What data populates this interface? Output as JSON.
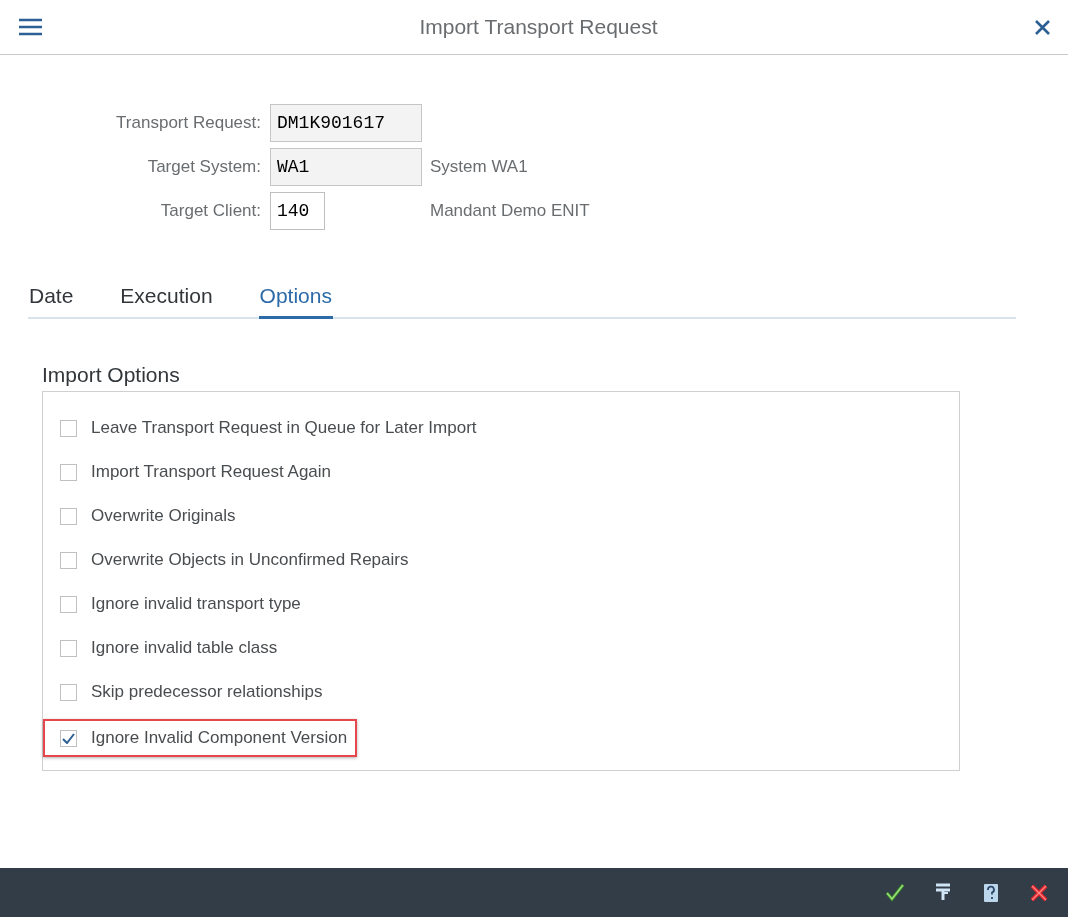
{
  "window": {
    "title": "Import Transport Request"
  },
  "fields": [
    {
      "label": "Transport Request:",
      "value": "DM1K901617",
      "editable": false
    },
    {
      "label": "Target System:",
      "value": "WA1",
      "editable": false,
      "description": "System WA1"
    },
    {
      "label": "Target Client:",
      "value": "140",
      "editable": true,
      "description": "Mandant Demo ENIT"
    }
  ],
  "tabs": [
    {
      "label": "Date",
      "selected": false
    },
    {
      "label": "Execution",
      "selected": false
    },
    {
      "label": "Options",
      "selected": true
    }
  ],
  "import_options": {
    "title": "Import Options",
    "options": [
      {
        "label": "Leave Transport Request in Queue for Later Import",
        "checked": false,
        "highlighted": false
      },
      {
        "label": "Import Transport Request Again",
        "checked": false,
        "highlighted": false
      },
      {
        "label": "Overwrite Originals",
        "checked": false,
        "highlighted": false
      },
      {
        "label": "Overwrite Objects in Unconfirmed Repairs",
        "checked": false,
        "highlighted": false
      },
      {
        "label": "Ignore invalid transport type",
        "checked": false,
        "highlighted": false
      },
      {
        "label": "Ignore invalid table class",
        "checked": false,
        "highlighted": false
      },
      {
        "label": "Skip predecessor relationships",
        "checked": false,
        "highlighted": false
      },
      {
        "label": "Ignore Invalid Component Version",
        "checked": true,
        "highlighted": true
      }
    ]
  },
  "footer_buttons": [
    {
      "kind": "confirm"
    },
    {
      "kind": "filter"
    },
    {
      "kind": "help"
    },
    {
      "kind": "cancel"
    }
  ]
}
